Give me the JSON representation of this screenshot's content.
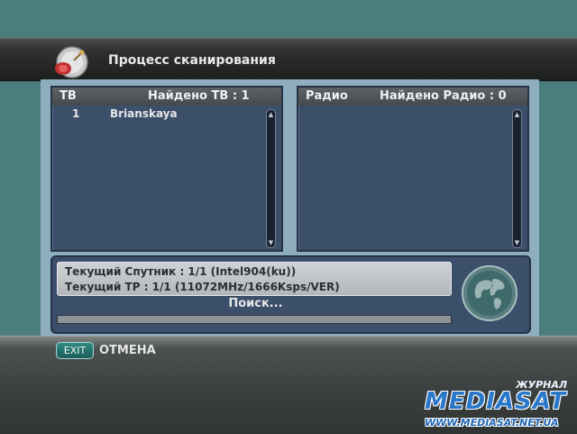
{
  "header": {
    "title": "Процесс сканирования",
    "icon": "satellite-dish-icon"
  },
  "tv_panel": {
    "label": "ТВ",
    "found": "Найдено ТВ : 1",
    "channels": [
      {
        "number": "1",
        "name": "Brianskaya"
      }
    ]
  },
  "radio_panel": {
    "label": "Радио",
    "found": "Найдено Радио : 0",
    "channels": []
  },
  "scan": {
    "satellite": "Текущий Спутник : 1/1  (Intel904(ku))",
    "transponder": "Текущий ТР : 1/1  (11072MHz/1666Ksps/VER)",
    "status": "Поиск...",
    "progress": 0
  },
  "footer": {
    "exit_key": "EXIT",
    "exit_label": "ОТМЕНА"
  },
  "watermark": {
    "journal": "ЖУРНАЛ",
    "brand": "MEDIASAT",
    "url": "WWW.MEDIASAT.NET.UA"
  },
  "colors": {
    "background": "#4a7e7c",
    "panel": "#3b4e6a",
    "accent": "#2a78c9"
  }
}
